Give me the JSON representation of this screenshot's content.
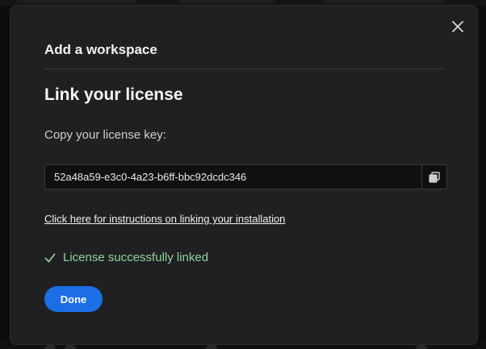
{
  "dialog": {
    "title": "Add a workspace",
    "section_title": "Link your license",
    "copy_label": "Copy your license key:",
    "license_key": "52a48a59-e3c0-4a23-b6ff-bbc92dcdc346",
    "instructions_link": "Click here for instructions on linking your installation",
    "success_message": "License successfully linked",
    "done_label": "Done"
  },
  "icons": {
    "close": "close-icon",
    "copy": "copy-icon",
    "success": "check-icon"
  },
  "colors": {
    "modal_background": "#202022",
    "primary_button": "#1b6ee6",
    "success_text": "#8fd49a"
  }
}
